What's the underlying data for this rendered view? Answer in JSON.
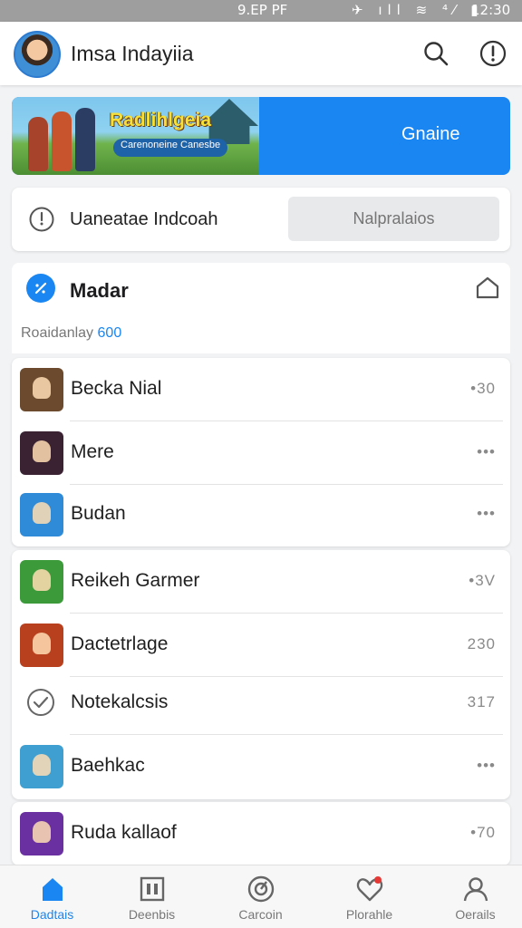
{
  "status_bar": {
    "carrier": "9.EP PF",
    "icons": "✈ ıll ≋ ⁴⁄ ▮",
    "time": "12:30"
  },
  "header": {
    "title": "Imsa Indayiia",
    "avatar": "avatar",
    "search_icon": "search-icon",
    "info_icon": "info-icon"
  },
  "banner": {
    "game_title": "Radlihlgeia",
    "subtitle": "Carenoneine Canesbe",
    "cta": "Gnaine"
  },
  "search": {
    "label": "Uaneatae Indcoah",
    "placeholder": "Nalpralaios"
  },
  "section": {
    "title": "Madar",
    "subtitle_text": "Roaidanlay",
    "subtitle_num": "600"
  },
  "games": [
    {
      "name": "Becka Nial",
      "meta": "•30",
      "thumb": "#6b4a2e"
    },
    {
      "name": "Mere",
      "meta": "•••",
      "thumb": "#3a2233"
    },
    {
      "name": "Budan",
      "meta": "•••",
      "thumb": "#2f8ad8"
    },
    {
      "name": "Reikeh Garmer",
      "meta": "•3V",
      "thumb": "#3c9a3a"
    },
    {
      "name": "Dactetrlage",
      "meta": "230",
      "thumb": "#b8401f"
    },
    {
      "name": "Notekalcsis",
      "meta": "317",
      "thumb": ""
    },
    {
      "name": "Baehkac",
      "meta": "•••",
      "thumb": "#3f9fd0"
    },
    {
      "name": "Ruda kallaof",
      "meta": "•70",
      "thumb": "#6a2fa0"
    }
  ],
  "nav": [
    {
      "label": "Dadtais",
      "icon": "home-icon"
    },
    {
      "label": "Deenbis",
      "icon": "store-icon"
    },
    {
      "label": "Carcoin",
      "icon": "gauge-icon"
    },
    {
      "label": "Plorahle",
      "icon": "heart-icon"
    },
    {
      "label": "Oerails",
      "icon": "person-icon"
    }
  ],
  "colors": {
    "accent": "#1a86f2",
    "banner_blue": "#1a86f2",
    "title_yellow": "#f5e03a"
  }
}
